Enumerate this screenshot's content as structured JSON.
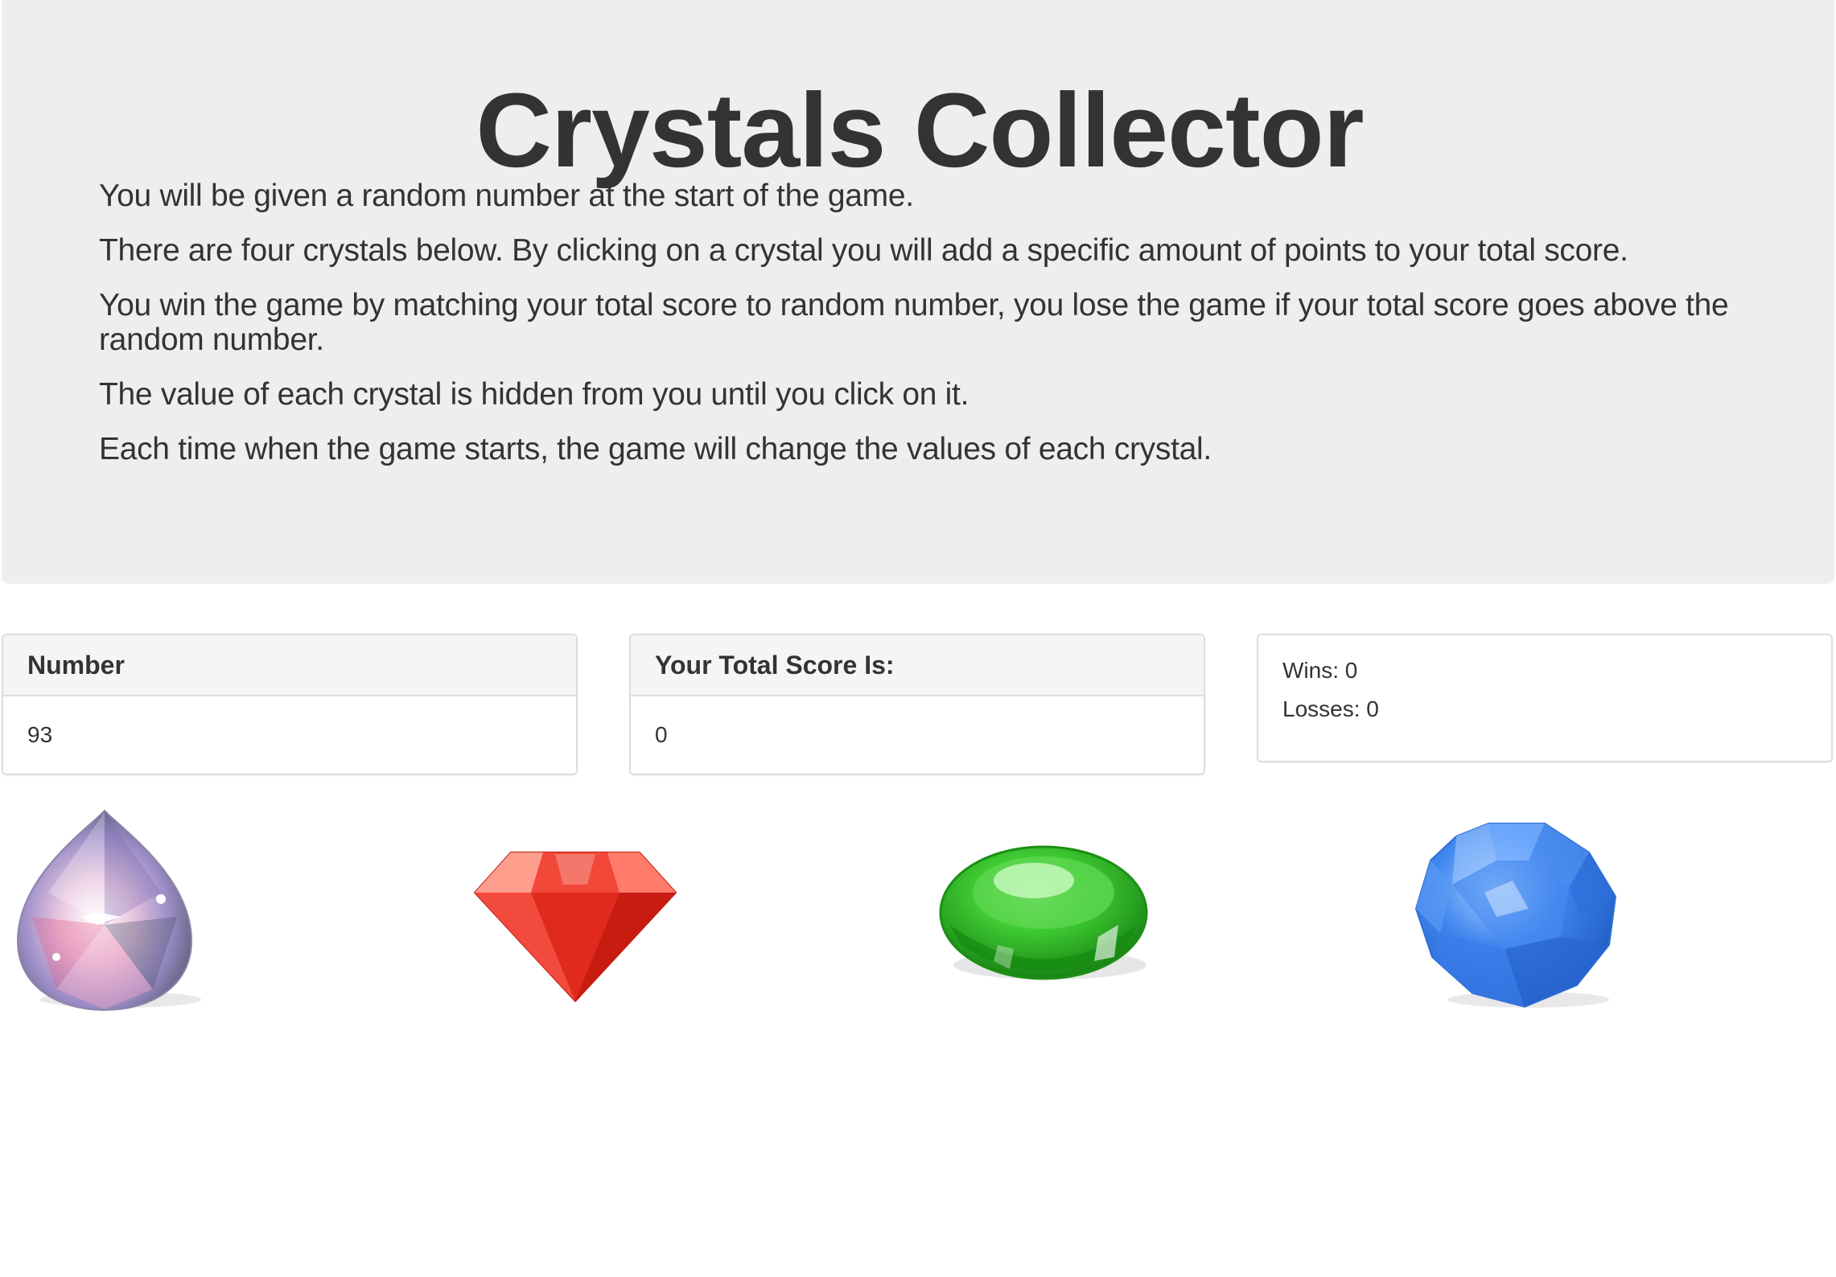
{
  "header": {
    "title": "Crystals Collector",
    "instructions": [
      "You will be given a random number at the start of the game.",
      "There are four crystals below. By clicking on a crystal you will add a specific amount of points to your total score.",
      "You win the game by matching your total score to random number, you lose the game if your total score goes above the random number.",
      "The value of each crystal is hidden from you until you click on it.",
      "Each time when the game starts, the game will change the values of each crystal."
    ]
  },
  "panels": {
    "number": {
      "heading": "Number",
      "value": "93"
    },
    "score": {
      "heading": "Your Total Score Is:",
      "value": "0"
    },
    "stats": {
      "wins": "Wins: 0",
      "losses": "Losses: 0"
    }
  },
  "crystals": [
    {
      "icon": "clear-drop-crystal-icon",
      "color": "#c9b8e8"
    },
    {
      "icon": "red-diamond-crystal-icon",
      "color": "#e8362c"
    },
    {
      "icon": "green-oval-crystal-icon",
      "color": "#2fb526"
    },
    {
      "icon": "blue-round-crystal-icon",
      "color": "#3b7fe8"
    }
  ],
  "colors": {
    "jumbotron_bg": "#eeeeee",
    "panel_heading_bg": "#f5f5f5",
    "panel_border": "#dddddd",
    "text": "#333333"
  }
}
